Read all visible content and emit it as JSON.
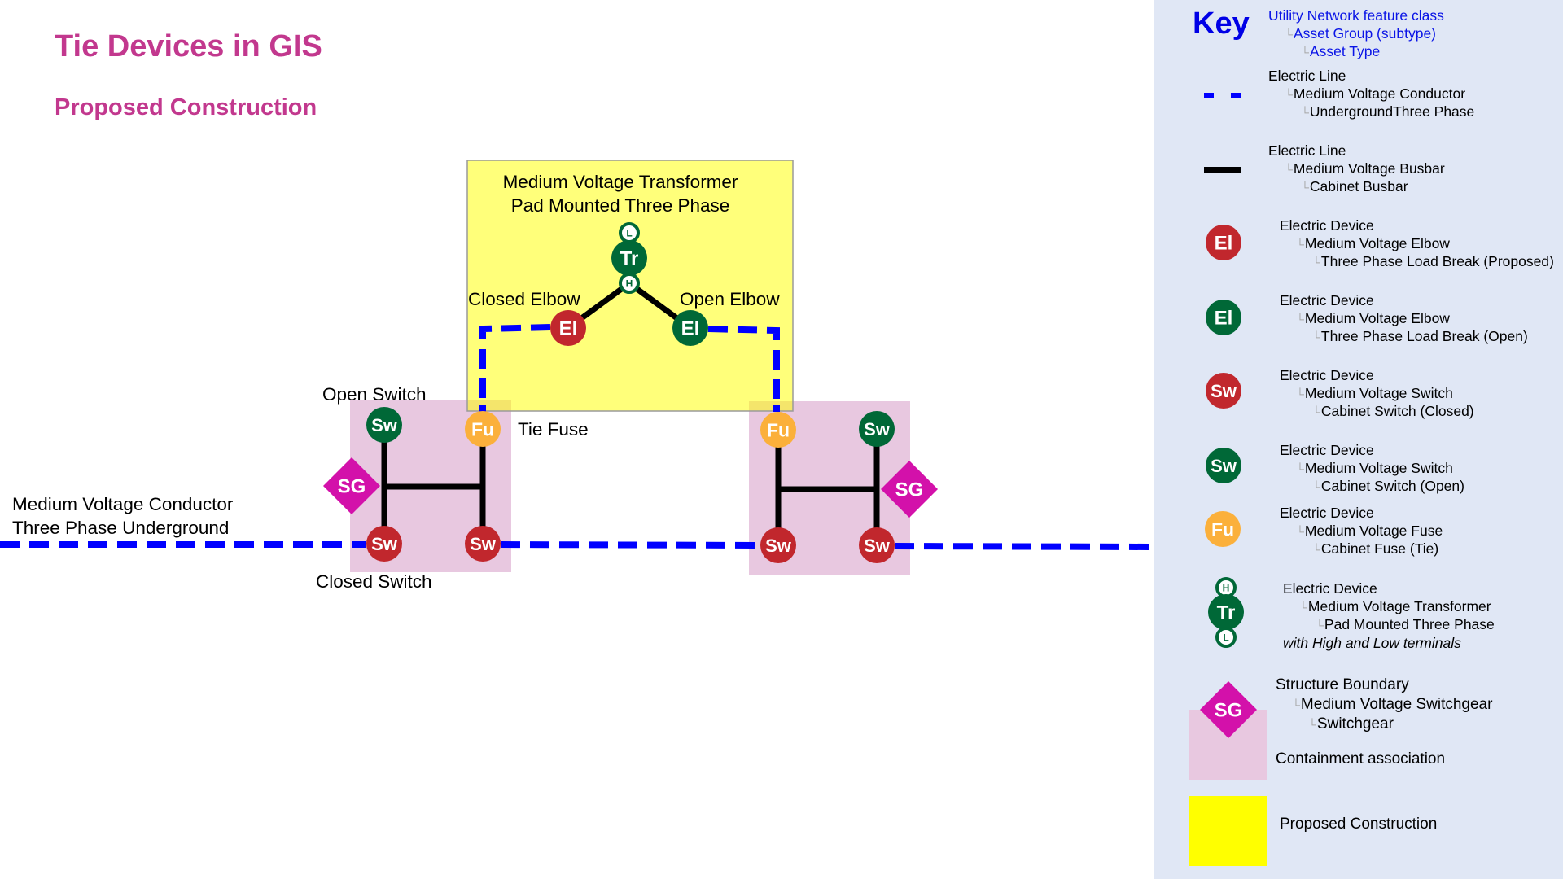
{
  "header": {
    "title": "Tie Devices in GIS",
    "subtitle": "Proposed Construction"
  },
  "colors": {
    "title": "#c2388e",
    "conductor": "#0000ff",
    "busbar": "#000000",
    "closed_red": "#c1272d",
    "open_green": "#006837",
    "fuse_orange": "#fbb03b",
    "switchgear_magenta": "#d311aa",
    "containment_pink": "#e8c8e0",
    "proposed_yellow": "#ffff00",
    "key_background": "#e0e7f5",
    "key_heading": "#0000e6"
  },
  "diagram": {
    "labels": {
      "transformer_line1": "Medium Voltage Transformer",
      "transformer_line2": "Pad Mounted Three Phase",
      "closed_elbow": "Closed Elbow",
      "open_elbow": "Open Elbow",
      "open_switch": "Open Switch",
      "tie_fuse": "Tie Fuse",
      "closed_switch": "Closed Switch",
      "conductor_line1": "Medium Voltage Conductor",
      "conductor_line2": "Three Phase Underground"
    },
    "symbols": {
      "switch": "Sw",
      "fuse": "Fu",
      "elbow": "El",
      "transformer": "Tr",
      "high_terminal": "H",
      "low_terminal": "L",
      "switchgear": "SG"
    }
  },
  "key": {
    "title": "Key",
    "hierarchy": {
      "level1": "Utility Network feature class",
      "level2": "Asset Group (subtype)",
      "level3": "Asset Type"
    },
    "entries": [
      {
        "symbol": "dashed-blue-line",
        "l1": "Electric Line",
        "l2": "Medium Voltage Conductor",
        "l3": "UndergroundThree Phase"
      },
      {
        "symbol": "black-busbar-line",
        "l1": "Electric Line",
        "l2": "Medium Voltage Busbar",
        "l3": "Cabinet Busbar"
      },
      {
        "symbol": "El",
        "l1": "Electric Device",
        "l2": "Medium Voltage Elbow",
        "l3": "Three Phase Load Break (Proposed)"
      },
      {
        "symbol": "El",
        "l1": "Electric Device",
        "l2": "Medium Voltage Elbow",
        "l3": "Three Phase Load Break (Open)"
      },
      {
        "symbol": "Sw",
        "l1": "Electric Device",
        "l2": "Medium Voltage Switch",
        "l3": "Cabinet Switch (Closed)"
      },
      {
        "symbol": "Sw",
        "l1": "Electric Device",
        "l2": "Medium Voltage Switch",
        "l3": "Cabinet Switch (Open)"
      },
      {
        "symbol": "Fu",
        "l1": "Electric Device",
        "l2": "Medium Voltage Fuse",
        "l3": "Cabinet Fuse (Tie)"
      },
      {
        "symbol": "Tr",
        "l1": "Electric Device",
        "l2": "Medium Voltage Transformer",
        "l3": "Pad Mounted Three Phase",
        "note": "with High and Low terminals"
      },
      {
        "symbol": "SG",
        "l1": "Structure Boundary",
        "l2": "Medium Voltage Switchgear",
        "l3": "Switchgear",
        "extra": "Containment association"
      },
      {
        "symbol": "yellow-square",
        "l1": "Proposed Construction"
      }
    ]
  }
}
